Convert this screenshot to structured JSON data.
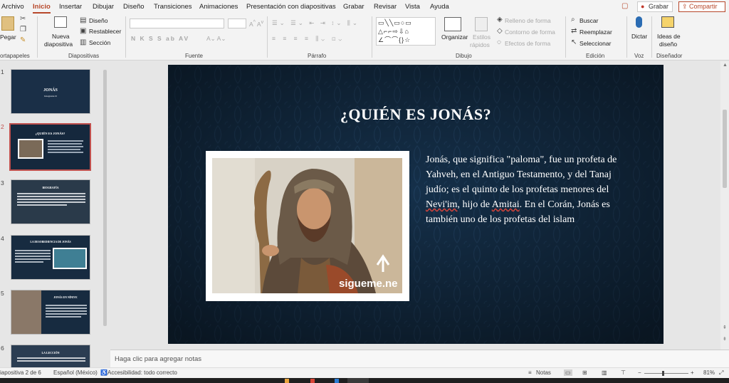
{
  "menu": {
    "tabs": [
      "Archivo",
      "Inicio",
      "Insertar",
      "Dibujar",
      "Diseño",
      "Transiciones",
      "Animaciones",
      "Presentación con diapositivas",
      "Grabar",
      "Revisar",
      "Vista",
      "Ayuda"
    ],
    "grabar": "Grabar",
    "compartir": "Compartir"
  },
  "ribbon": {
    "portapapeles": {
      "pegar": "Pegar",
      "label": "ortapapeles"
    },
    "diapositivas": {
      "nueva": "Nueva",
      "nueva2": "diapositiva",
      "diseno": "Diseño",
      "restablecer": "Restablecer",
      "seccion": "Sección",
      "label": "Diapositivas"
    },
    "fuente": {
      "label": "Fuente",
      "styles": "N  K  S  S  ab  AV"
    },
    "parrafo": {
      "label": "Párrafo"
    },
    "dibujo": {
      "organizar": "Organizar",
      "estilos": "Estilos",
      "estilos2": "rápidos",
      "relleno": "Relleno de forma",
      "contorno": "Contorno de forma",
      "efectos": "Efectos de forma",
      "label": "Dibujo"
    },
    "edicion": {
      "buscar": "Buscar",
      "reemplazar": "Reemplazar",
      "seleccionar": "Seleccionar",
      "label": "Edición"
    },
    "voz": {
      "dictar": "Dictar",
      "label": "Voz"
    },
    "disenador": {
      "ideas": "Ideas de",
      "ideas2": "diseño",
      "label": "Diseñador"
    }
  },
  "thumbnails": [
    {
      "num": "1",
      "title": "JONÁS",
      "sub": "Integrante II"
    },
    {
      "num": "2",
      "title": "¿QUIÉN ES JONÁS?"
    },
    {
      "num": "3",
      "title": "BIOGRAFÍA"
    },
    {
      "num": "4",
      "title": "LA DESOBEDIENCIA DE JONÁS"
    },
    {
      "num": "5",
      "title": "JONÁS EN NÍNIVE"
    },
    {
      "num": "6",
      "title": "LA LECCIÓN"
    }
  ],
  "slide": {
    "title": "¿QUIÉN ES JONÁS?",
    "body_1": "Jonás, que significa \"paloma\", fue un profeta de Yahveh, en el Antiguo Testamento, y del Tanaj judío; es el quinto de los profetas menores del ",
    "body_w1": "Nevi'im",
    "body_2": ", hijo de ",
    "body_w2": "Amitai",
    "body_3": ". En el Corán, Jonás es también uno de los profetas del islam",
    "watermark": "sigueme.ne"
  },
  "notes_placeholder": "Haga clic para agregar notas",
  "status": {
    "slide": "iapositiva 2 de 6",
    "language": "Español (México)",
    "accessibility": "Accesibilidad: todo correcto",
    "notes": "Notas",
    "zoom": "81%"
  },
  "colors": {
    "accent": "#b7472a",
    "slide_bg": "#13283e"
  }
}
